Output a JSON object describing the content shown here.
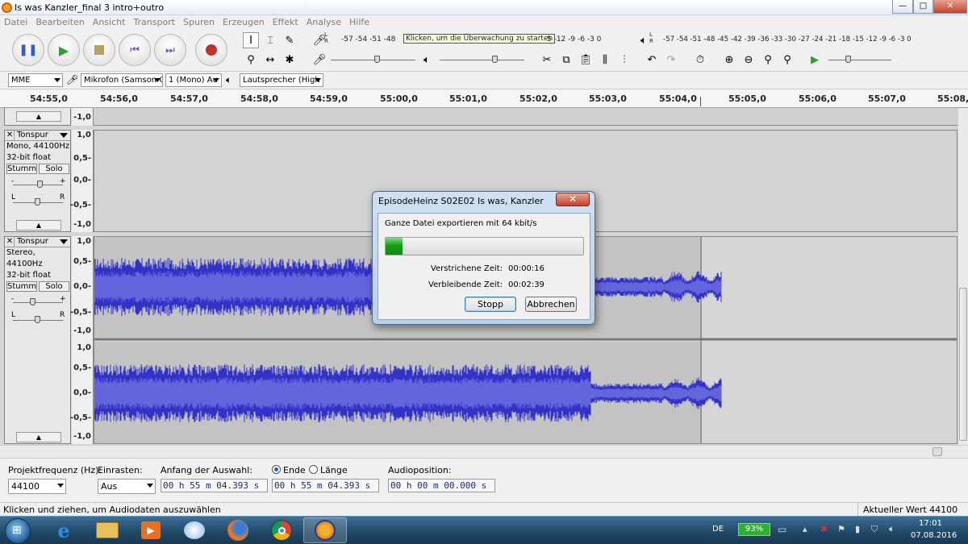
{
  "window": {
    "title": "Is was Kanzler_final 3 intro+outro",
    "minimize": "—",
    "maximize": "□",
    "close": "✕"
  },
  "menu": [
    "Datei",
    "Bearbeiten",
    "Ansicht",
    "Transport",
    "Spuren",
    "Erzeugen",
    "Effekt",
    "Analyse",
    "Hilfe"
  ],
  "meters": {
    "rec_scale": "-57 -54 -51 -48",
    "rec_scale_tail": "5 -12 -9 -6 -3 0",
    "rec_tooltip": "Klicken, um die Überwachung zu starten",
    "play_scale": "-57 -54 -51 -48 -45 -42 -39 -36 -33 -30 -27 -24 -21 -18 -15 -12 -9 -6 -3 0",
    "lr_l": "L",
    "lr_r": "R"
  },
  "devices": {
    "host": "MME",
    "mic": "Mikrofon (Samson C",
    "channels": "1 (Mono) Au",
    "speaker": "Lautsprecher (High I"
  },
  "ruler": [
    "54:55,0",
    "54:56,0",
    "54:57,0",
    "54:58,0",
    "54:59,0",
    "55:00,0",
    "55:01,0",
    "55:02,0",
    "55:03,0",
    "55:04,0",
    "55:05,0",
    "55:06,0",
    "55:07,0",
    "55:08,0"
  ],
  "tracks": [
    {
      "name": "Tonspur",
      "info1": "Mono, 44100Hz",
      "info2": "32-bit float",
      "mute": "Stumm",
      "solo": "Solo",
      "scale": [
        "1,0",
        "0,5-",
        "0,0-",
        "-0,5-",
        "-1,0"
      ]
    },
    {
      "name": "Tonspur",
      "info1": "Stereo, 44100Hz",
      "info2": "32-bit float",
      "mute": "Stumm",
      "solo": "Solo",
      "scale": [
        "1,0",
        "0,5-",
        "0,0-",
        "-0,5-",
        "-1,0"
      ],
      "scale2": [
        "1,0",
        "0,5-",
        "0,0-",
        "-0,5-",
        "-1,0"
      ]
    }
  ],
  "top_scale_remnant": "-1,0",
  "pan": {
    "minus": "-",
    "plus": "+",
    "l": "L",
    "r": "R"
  },
  "selection": {
    "rate_label": "Projektfrequenz (Hz):",
    "rate_value": "44100",
    "snap_label": "Einrasten:",
    "snap_value": "Aus",
    "start_label": "Anfang der Auswahl:",
    "end_label": "Ende",
    "length_label": "Länge",
    "start_time": "00 h 55 m 04.393 s",
    "end_time": "00 h 55 m 04.393 s",
    "audio_label": "Audioposition:",
    "audio_time": "00 h 00 m 00.000 s"
  },
  "status": {
    "left": "Klicken und ziehen, um Audiodaten auszuwählen",
    "right": "Aktueller Wert 44100"
  },
  "dialog": {
    "title": "EpisodeHeinz S02E02 Is was, Kanzler",
    "message": "Ganze Datei exportieren mit 64 kbit/s",
    "progress": 0.085,
    "elapsed_label": "Verstrichene Zeit:",
    "elapsed": "00:00:16",
    "remaining_label": "Verbleibende Zeit:",
    "remaining": "00:02:39",
    "stop": "Stopp",
    "cancel": "Abbrechen",
    "close": "✕"
  },
  "taskbar": {
    "lang": "DE",
    "battery": "93%",
    "time": "17:01",
    "date": "07.08.2016"
  },
  "colors": {
    "wave": "#3232c8",
    "wave_light": "#6464dc",
    "progress": "#22b022",
    "record": "#c03030",
    "play": "#30a030"
  }
}
